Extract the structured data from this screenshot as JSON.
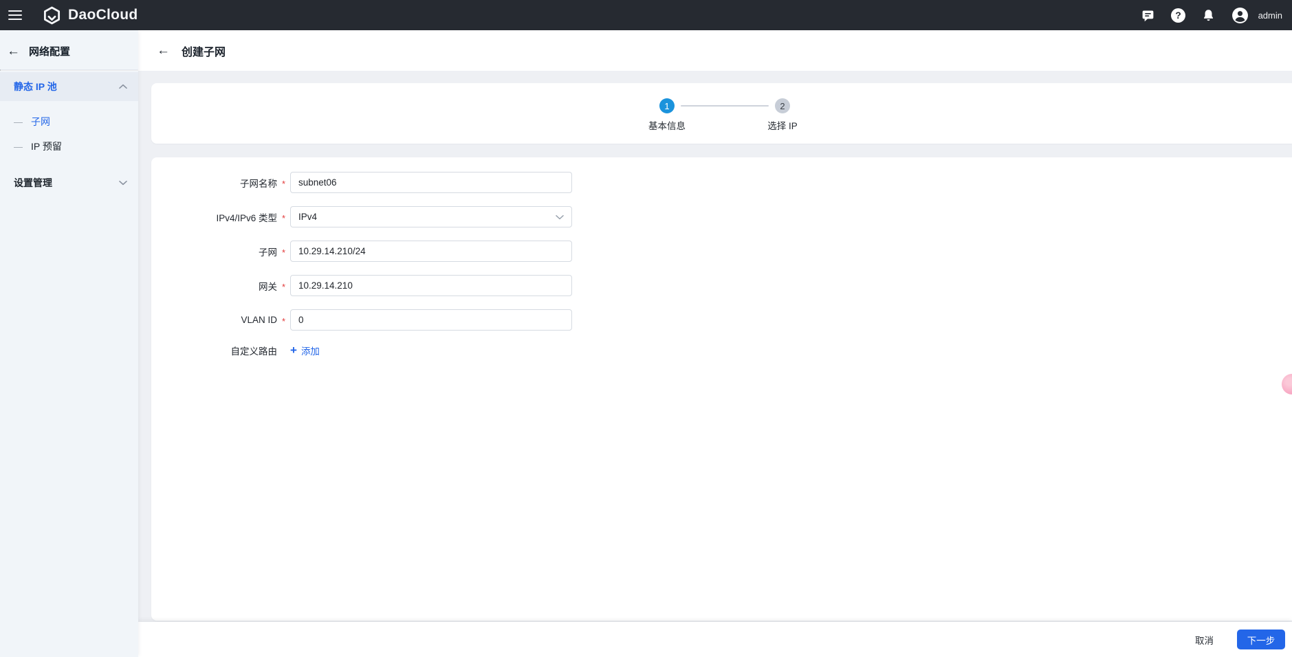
{
  "colors": {
    "topbar-bg": "#262a31",
    "sidebar-bg": "#f1f5f9",
    "sidebar-active-bg": "#e7ecf3",
    "accent-blue": "#2366e8",
    "step-active-blue": "#1b93dc",
    "page-bg": "#eef0f4",
    "pink-fab": "#f7a6c0"
  },
  "topbar": {
    "brand": "DaoCloud",
    "username": "admin"
  },
  "sidebar": {
    "title": "网络配置",
    "group1": {
      "label": "静态 IP 池",
      "items": [
        {
          "label": "子网",
          "active": true
        },
        {
          "label": "IP 预留",
          "active": false
        }
      ]
    },
    "group2": {
      "label": "设置管理"
    }
  },
  "page": {
    "title": "创建子网",
    "stepper": {
      "step1": {
        "number": "1",
        "label": "基本信息",
        "state": "active"
      },
      "step2": {
        "number": "2",
        "label": "选择 IP",
        "state": "pending"
      }
    },
    "form": {
      "fields": [
        {
          "label": "子网名称",
          "required": "*",
          "type": "input",
          "value": "subnet06"
        },
        {
          "label": "IPv4/IPv6 类型",
          "required": "*",
          "type": "select",
          "value": "IPv4"
        },
        {
          "label": "子网",
          "required": "*",
          "type": "input",
          "value": "10.29.14.210/24"
        },
        {
          "label": "网关",
          "required": "*",
          "type": "input",
          "value": "10.29.14.210"
        },
        {
          "label": "VLAN ID",
          "required": "*",
          "type": "input",
          "value": "0"
        }
      ],
      "custom_route_label": "自定义路由",
      "add_link": "添加"
    },
    "footer": {
      "cancel": "取消",
      "next": "下一步"
    }
  }
}
